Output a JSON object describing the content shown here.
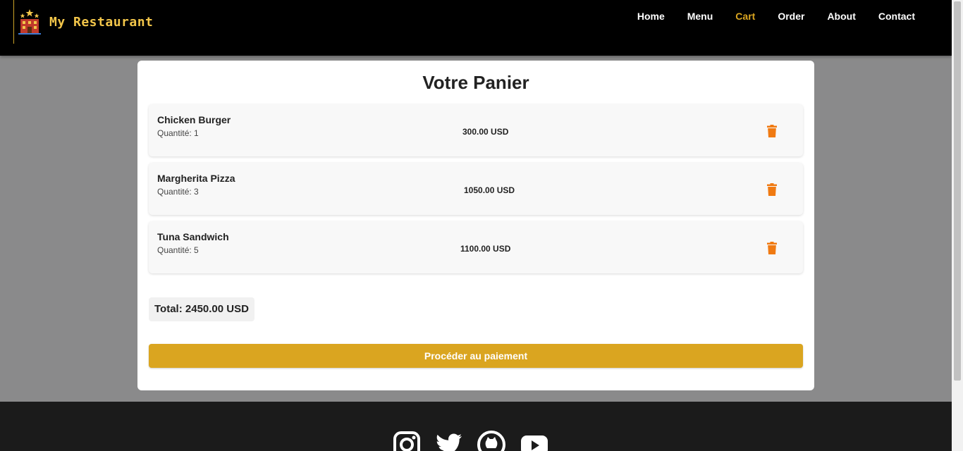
{
  "brand": {
    "name": "My Restaurant"
  },
  "nav": {
    "items": [
      {
        "label": "Home"
      },
      {
        "label": "Menu"
      },
      {
        "label": "Cart",
        "active": true
      },
      {
        "label": "Order"
      },
      {
        "label": "About"
      },
      {
        "label": "Contact"
      }
    ]
  },
  "cart": {
    "title": "Votre Panier",
    "items": [
      {
        "name": "Chicken Burger",
        "quantity": "Quantité: 1",
        "price": "300.00 USD"
      },
      {
        "name": "Margherita Pizza",
        "quantity": "Quantité: 3",
        "price": "1050.00 USD"
      },
      {
        "name": "Tuna Sandwich",
        "quantity": "Quantité: 5",
        "price": "1100.00 USD"
      }
    ],
    "total": "Total: 2450.00 USD",
    "checkout_label": "Procéder au paiement"
  },
  "footer": {
    "social": [
      "instagram-icon",
      "twitter-icon",
      "github-icon",
      "youtube-icon"
    ]
  },
  "colors": {
    "accent": "#daa520",
    "trash": "#f07a12",
    "navbar": "#000000",
    "footer": "#1b1b1b"
  }
}
